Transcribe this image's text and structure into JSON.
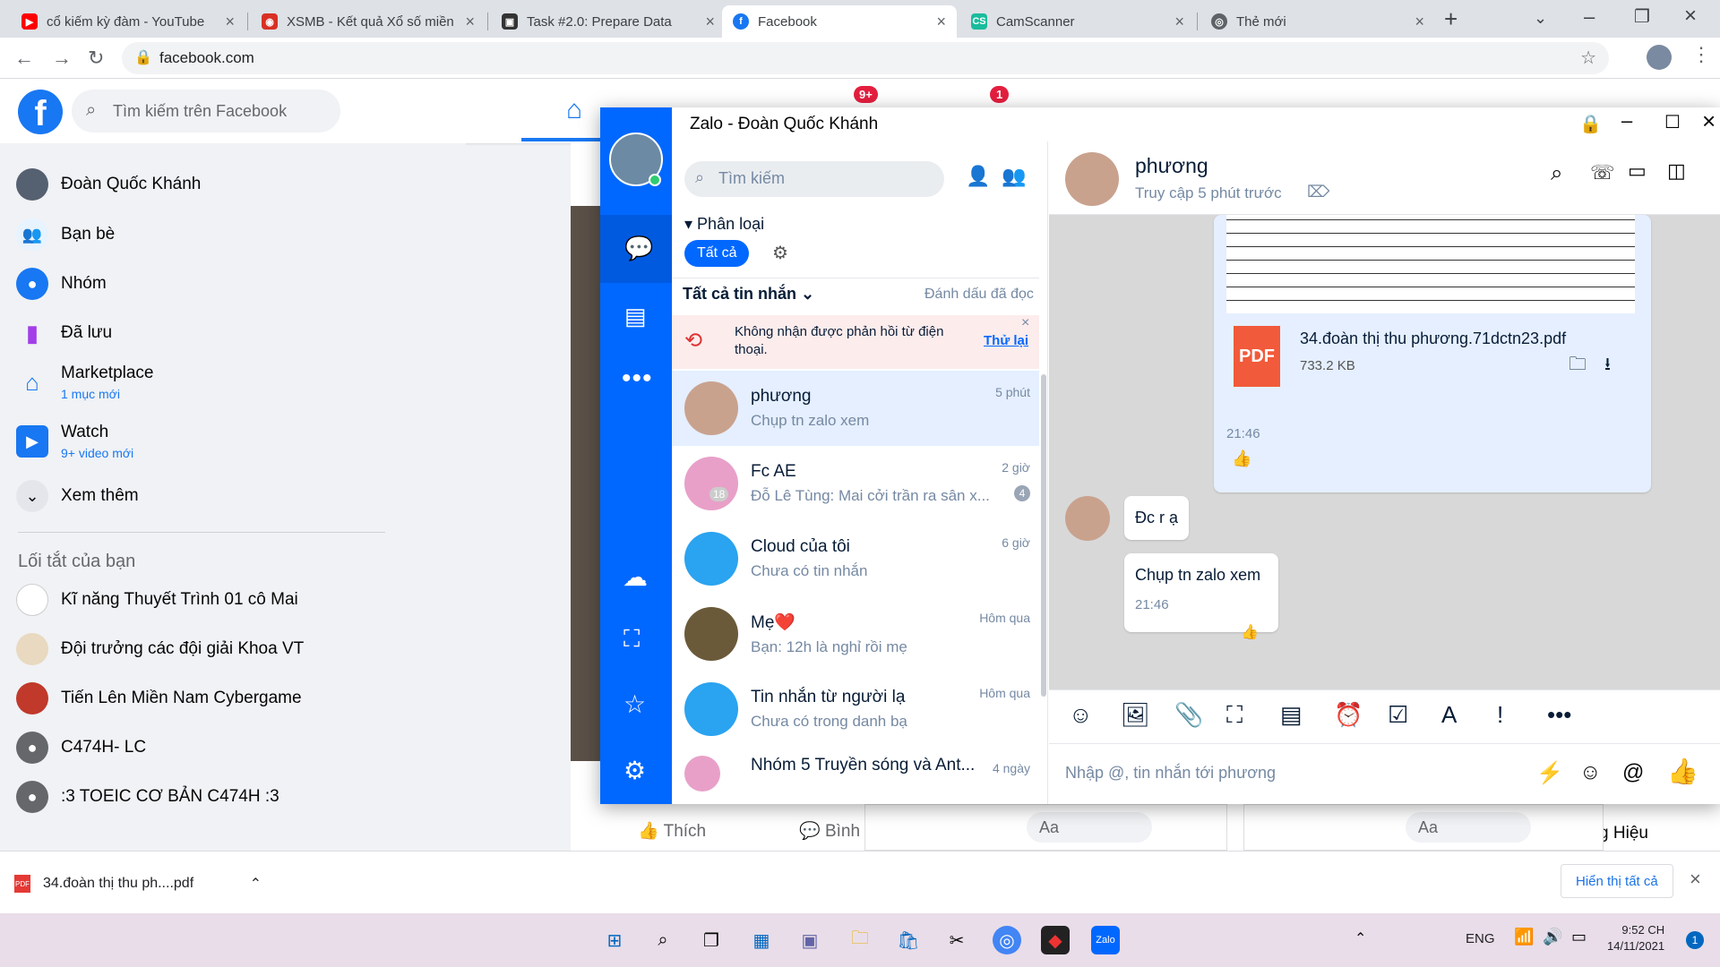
{
  "tabs": [
    {
      "title": "cổ kiếm kỳ đàm - YouTube",
      "icon": "youtube-icon",
      "color": "#ff0000"
    },
    {
      "title": "XSMB - Kết quả Xổ số miền",
      "icon": "xsmb-icon",
      "color": "#d93025"
    },
    {
      "title": "Task #2.0: Prepare Data",
      "icon": "task-icon",
      "color": "#333333"
    },
    {
      "title": "Facebook",
      "icon": "facebook-icon",
      "color": "#1877f2"
    },
    {
      "title": "CamScanner",
      "icon": "camscanner-icon",
      "color": "#19bc9c"
    },
    {
      "title": "Thẻ mới",
      "icon": "chrome-icon",
      "color": "#5f6368"
    }
  ],
  "address": {
    "url": "facebook.com"
  },
  "fb": {
    "search_placeholder": "Tìm kiếm trên Facebook",
    "badge_notifications": "9+",
    "badge_messages": "1",
    "left": [
      {
        "label": "Đoàn Quốc Khánh",
        "sub": ""
      },
      {
        "label": "Bạn bè",
        "sub": ""
      },
      {
        "label": "Nhóm",
        "sub": ""
      },
      {
        "label": "Đã lưu",
        "sub": ""
      },
      {
        "label": "Marketplace",
        "sub": "1 mục mới"
      },
      {
        "label": "Watch",
        "sub": "9+ video mới"
      },
      {
        "label": "Xem thêm",
        "sub": ""
      }
    ],
    "shortcuts_title": "Lối tắt của bạn",
    "shortcuts": [
      "Kĩ năng Thuyết Trình 01 cô Mai",
      "Đội trưởng các đội giải Khoa VT",
      "Tiến Lên Miền Nam Cybergame",
      "C474H- LC",
      ":3 TOEIC CƠ BẢN C474H :3"
    ],
    "like": "Thích",
    "comment": "Bình",
    "aa": "Aa",
    "aa2": "Aa",
    "name_partial": "ơng Hiệu"
  },
  "zalo": {
    "title": "Zalo - Đoàn Quốc Khánh",
    "search_placeholder": "Tìm kiếm",
    "classify": "Phân loại",
    "filter_all": "Tất cả",
    "all_messages": "Tất cả tin nhắn",
    "mark_read": "Đánh dấu đã đọc",
    "warning": "Không nhận được phản hồi từ điện thoại.",
    "retry": "Thử lại",
    "conversations": [
      {
        "name": "phương",
        "preview": "Chụp tn zalo xem",
        "time": "5 phút",
        "color": "#c9a28e"
      },
      {
        "name": "Fc AE",
        "preview": "Đỗ Lê Tùng: Mai cởi trần ra sân x...",
        "time": "2 giờ",
        "color": "#e8a0c8",
        "count": "18",
        "badge": "4"
      },
      {
        "name": "Cloud của tôi",
        "preview": "Chưa có tin nhắn",
        "time": "6 giờ",
        "color": "#2aa3f0"
      },
      {
        "name": "Mẹ❤️",
        "preview": "Bạn: 12h là nghỉ rồi mẹ",
        "time": "Hôm qua",
        "color": "#6b5a3a"
      },
      {
        "name": "Tin nhắn từ người lạ",
        "preview": "Chưa có trong danh bạ",
        "time": "Hôm qua",
        "color": "#2aa3f0"
      },
      {
        "name": "Nhóm 5 Truyền sóng và Ant...",
        "preview": "",
        "time": "4 ngày",
        "color": "#e8a0c8"
      }
    ],
    "chat": {
      "name": "phương",
      "status": "Truy cập 5 phút trước",
      "file_name": "34.đoàn thị thu phương.71dctn23.pdf",
      "file_size": "733.2 KB",
      "file_time": "21:46",
      "msg1": "Đc r ạ",
      "msg2": "Chụp tn zalo xem",
      "msg2_time": "21:46",
      "input_placeholder": "Nhập @, tin nhắn tới phương"
    }
  },
  "download": {
    "file": "34.đoàn thị thu ph....pdf",
    "show_all": "Hiển thị tất cả"
  },
  "taskbar": {
    "lang": "ENG",
    "time": "9:52 CH",
    "date": "14/11/2021",
    "notif": "1"
  }
}
